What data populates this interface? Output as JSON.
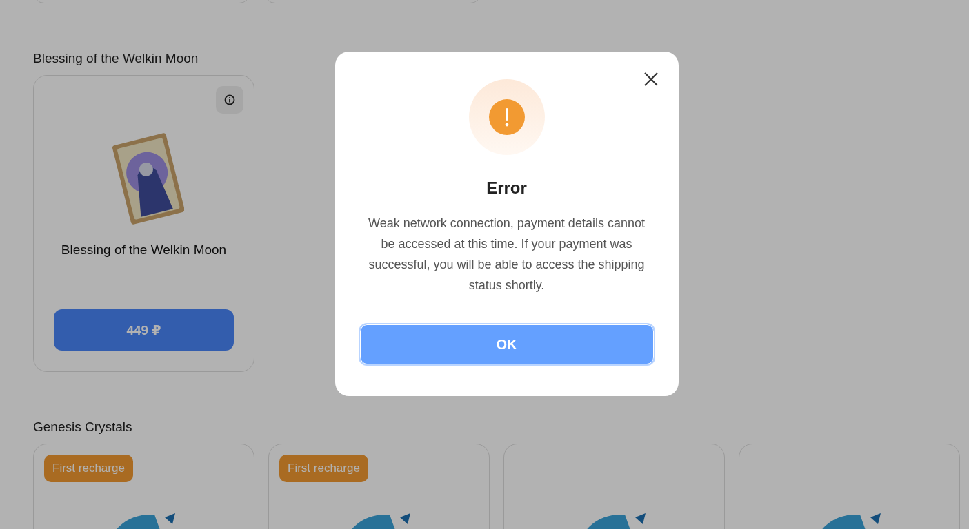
{
  "sections": [
    {
      "kind": "welkin",
      "title": "Blessing of the Welkin Moon",
      "cards": [
        {
          "name": "Blessing of the Welkin Moon",
          "price": "449 ₽"
        }
      ]
    },
    {
      "kind": "crystals",
      "title": "Genesis Crystals",
      "cards": [
        {
          "kind": "badged",
          "badge": "First recharge"
        },
        {
          "kind": "badged",
          "badge": "First recharge"
        },
        {
          "kind": "plain"
        },
        {
          "kind": "plain"
        }
      ]
    }
  ],
  "dialog": {
    "title": "Error",
    "message": "Weak network connection, payment details cannot be accessed at this time. If your payment was successful, you will be able to access the shipping status shortly.",
    "button": "OK"
  }
}
